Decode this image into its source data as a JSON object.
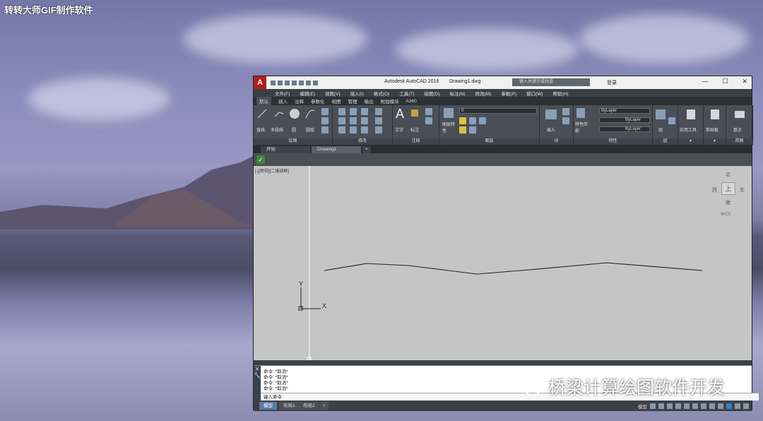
{
  "watermark": "转转大师GIF制作软件",
  "app": {
    "title": "Autodesk AutoCAD 2016",
    "doc": "Drawing1.dwg",
    "search_placeholder": "键入关键字或短语",
    "login": "登录",
    "logo": "A"
  },
  "window_controls": {
    "minimize": "—",
    "maximize": "☐",
    "close": "✕"
  },
  "menu": [
    "文件(F)",
    "编辑(E)",
    "视图(V)",
    "插入(I)",
    "格式(O)",
    "工具(T)",
    "绘图(D)",
    "标注(N)",
    "修改(M)",
    "参数(P)",
    "窗口(W)",
    "帮助(H)"
  ],
  "ribbon_tabs": [
    "默认",
    "插入",
    "注释",
    "参数化",
    "视图",
    "管理",
    "输出",
    "附加模块",
    "A360"
  ],
  "ribbon": {
    "draw_group": "绘图",
    "line": "直线",
    "polyline": "多段线",
    "circle": "圆",
    "arc": "圆弧",
    "modify_group": "修改",
    "annotation_group": "注释",
    "text": "文字",
    "dim": "标注",
    "layer_group": "图层",
    "layer_props": "图层特性",
    "layer_value": "0",
    "block_group": "块",
    "insert": "插入",
    "prop_group": "特性",
    "match": "特性匹配",
    "bylayer1": "ByLayer",
    "bylayer2": "ByLayer",
    "bylayer3": "ByLayer",
    "group_group": "组",
    "group": "组",
    "util": "实用工具",
    "clipboard": "剪贴板",
    "base": "基点",
    "view_group": "视图"
  },
  "doc_tabs": {
    "start": "开始",
    "drawing": "Drawing1",
    "add": "+"
  },
  "viewport_label": "[-][俯视][二维线框]",
  "viewcube": {
    "top": "上",
    "n": "北",
    "s": "南",
    "w": "西",
    "e": "东",
    "wcs": "WCS"
  },
  "ucs": {
    "x": "X",
    "y": "Y"
  },
  "cmd_lines": [
    "命令: *取消*",
    "命令: *取消*",
    "命令: *取消*",
    "命令: *取消*"
  ],
  "cmd_prompt": "键入命令",
  "status": {
    "model": "模型",
    "layout1": "布局1",
    "layout2": "布局2",
    "add": "+",
    "model_right": "模型"
  },
  "wechat_text": "桥梁计算绘图软件开发"
}
